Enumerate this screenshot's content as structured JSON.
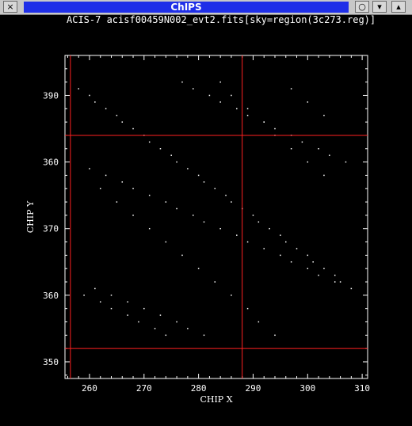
{
  "window": {
    "title": "ChIPS",
    "buttons": {
      "close": "×",
      "circle": "○",
      "down": "▾",
      "up": "▴"
    }
  },
  "colors": {
    "background": "#000000",
    "points": "#ffffff",
    "region_lines": "#ff2020",
    "titlebar_blue": "#1f2fe8"
  },
  "chart_data": {
    "type": "scatter",
    "title": "ACIS-7  acisf00459N002_evt2.fits[sky=region(3c273.reg)]",
    "xlabel": "CHIP X",
    "ylabel": "CHIP Y",
    "xlim": [
      255.5,
      311
    ],
    "ylim": [
      347.5,
      396
    ],
    "xticks": [
      260,
      270,
      280,
      290,
      300,
      310
    ],
    "yticks": [
      350,
      360,
      370,
      380,
      390
    ],
    "ytick_labels": [
      "350",
      "360",
      "370",
      "360",
      "390"
    ],
    "grid": false,
    "region_lines": {
      "vertical": [
        256.5,
        288
      ],
      "horizontal": [
        352,
        384
      ]
    },
    "points": {
      "description_range_x": [
        257.5,
        308.5
      ],
      "description_range_y": [
        353.5,
        393
      ],
      "x": [
        258,
        260,
        261,
        263,
        265,
        266,
        268,
        270,
        271,
        273,
        275,
        276,
        278,
        280,
        281,
        283,
        285,
        286,
        288,
        290,
        291,
        293,
        295,
        296,
        298,
        300,
        301,
        303,
        305,
        306,
        308,
        259,
        262,
        264,
        267,
        269,
        272,
        274,
        277,
        279,
        282,
        284,
        287,
        289,
        292,
        294,
        297,
        299,
        302,
        304,
        307,
        260,
        263,
        266,
        268,
        271,
        274,
        276,
        279,
        281,
        284,
        287,
        289,
        292,
        295,
        297,
        300,
        302,
        305,
        261,
        264,
        267,
        270,
        273,
        276,
        278,
        281,
        284,
        286,
        289,
        292,
        294,
        297,
        300,
        303,
        262,
        265,
        268,
        271,
        274,
        277,
        280,
        283,
        286,
        289,
        291,
        294,
        297,
        300,
        303,
        306
      ],
      "y": [
        391,
        390,
        389,
        388,
        387,
        386,
        385,
        384,
        383,
        382,
        381,
        380,
        379,
        378,
        377,
        376,
        375,
        374,
        373,
        372,
        371,
        370,
        369,
        368,
        367,
        366,
        365,
        364,
        363,
        362,
        361,
        360,
        359,
        358,
        357,
        356,
        355,
        354,
        392,
        391,
        390,
        389,
        388,
        387,
        386,
        385,
        384,
        383,
        382,
        381,
        380,
        379,
        378,
        377,
        376,
        375,
        374,
        373,
        372,
        371,
        370,
        369,
        368,
        367,
        366,
        365,
        364,
        363,
        362,
        361,
        360,
        359,
        358,
        357,
        356,
        355,
        354,
        392,
        390,
        388,
        386,
        384,
        382,
        380,
        378,
        376,
        374,
        372,
        370,
        368,
        366,
        364,
        362,
        360,
        358,
        356,
        354,
        391,
        389,
        387
      ]
    }
  }
}
